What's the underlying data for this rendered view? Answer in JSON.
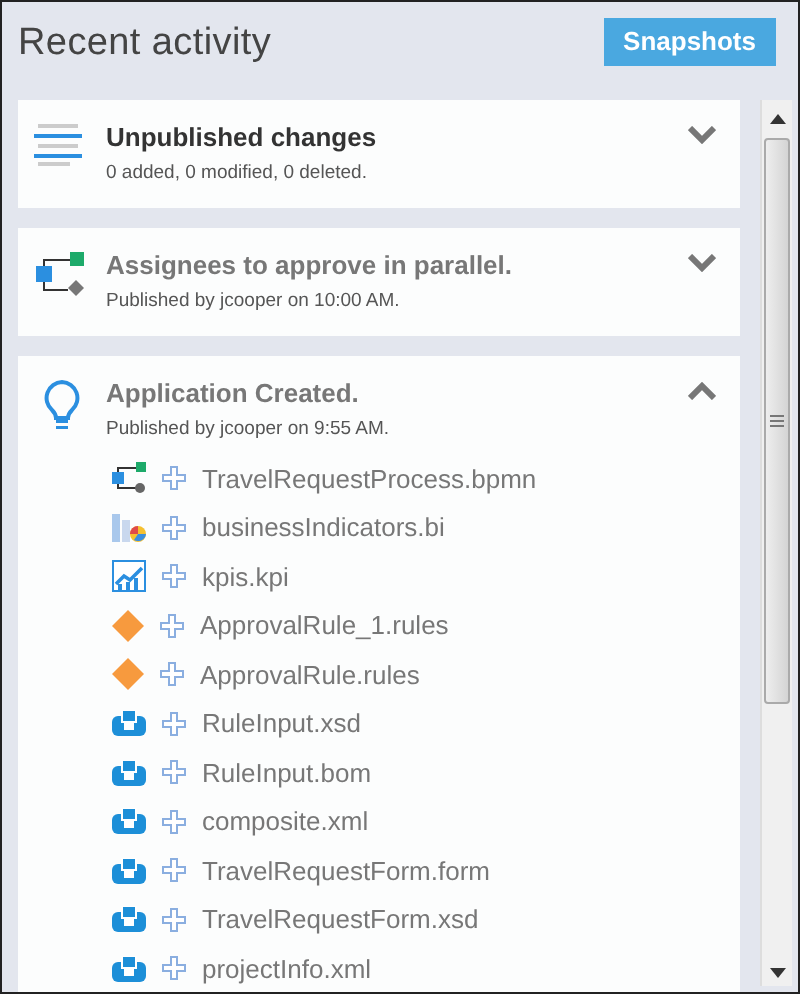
{
  "header": {
    "title": "Recent activity",
    "button": "Snapshots"
  },
  "activities": [
    {
      "kind": "changes",
      "title": "Unpublished changes",
      "subtitle": "0 added, 0 modified, 0 deleted.",
      "expanded": false
    },
    {
      "kind": "process",
      "title": "Assignees to approve in parallel.",
      "subtitle": "Published by jcooper on 10:00 AM.",
      "expanded": false
    },
    {
      "kind": "created",
      "title": "Application Created.",
      "subtitle": "Published by jcooper on 9:55 AM.",
      "expanded": true,
      "items": [
        {
          "kind": "process",
          "name": "TravelRequestProcess.bpmn"
        },
        {
          "kind": "indicators",
          "name": "businessIndicators.bi"
        },
        {
          "kind": "kpi",
          "name": "kpis.kpi"
        },
        {
          "kind": "rules",
          "name": "ApprovalRule_1.rules"
        },
        {
          "kind": "rules",
          "name": "ApprovalRule.rules"
        },
        {
          "kind": "data",
          "name": "RuleInput.xsd"
        },
        {
          "kind": "data",
          "name": "RuleInput.bom"
        },
        {
          "kind": "data",
          "name": "composite.xml"
        },
        {
          "kind": "data",
          "name": "TravelRequestForm.form"
        },
        {
          "kind": "data",
          "name": "TravelRequestForm.xsd"
        },
        {
          "kind": "data",
          "name": "projectInfo.xml"
        }
      ]
    }
  ]
}
